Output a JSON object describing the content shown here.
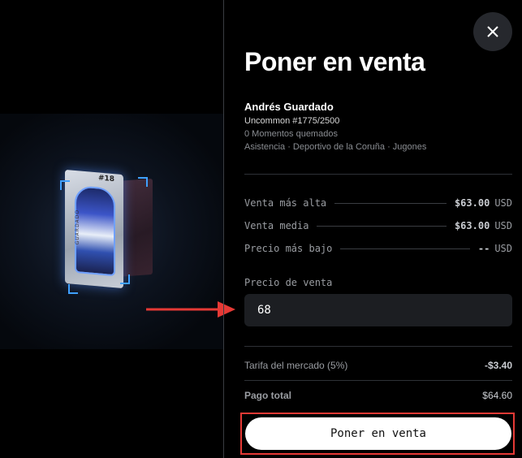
{
  "dialog": {
    "title": "Poner en venta",
    "close_icon": "close-icon"
  },
  "card": {
    "number": "#18",
    "name": "GUARDADO"
  },
  "player": {
    "name": "Andrés Guardado",
    "edition": "Uncommon #1775/2500",
    "burned": "0 Momentos quemados",
    "details": "Asistencia · Deportivo de la Coruña · Jugones"
  },
  "stats": [
    {
      "label": "Venta más alta",
      "value": "$63.00",
      "unit": "USD"
    },
    {
      "label": "Venta media",
      "value": "$63.00",
      "unit": "USD"
    },
    {
      "label": "Precio más bajo",
      "value": "--",
      "unit": "USD"
    }
  ],
  "price": {
    "label": "Precio de venta",
    "value": "68"
  },
  "fees": {
    "market_fee_label": "Tarifa del mercado (5%)",
    "market_fee_value": "-$3.40",
    "total_label": "Pago total",
    "total_value": "$64.60"
  },
  "cta": {
    "label": "Poner en venta"
  },
  "colors": {
    "annotation": "#e53935",
    "button_bg": "#ffffff",
    "close_bg": "#26282d"
  }
}
